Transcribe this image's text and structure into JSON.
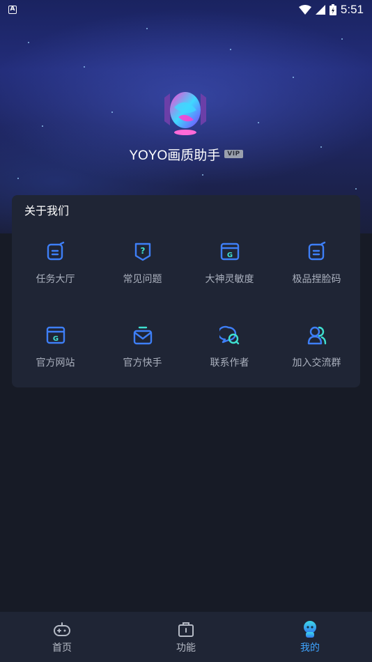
{
  "status_bar": {
    "time": "5:51",
    "badge": "A"
  },
  "app": {
    "name": "YOYO画质助手",
    "vip": "VIP"
  },
  "card": {
    "title": "关于我们",
    "items": [
      {
        "label": "任务大厅",
        "icon": "edit-icon"
      },
      {
        "label": "常见问题",
        "icon": "question-icon"
      },
      {
        "label": "大神灵敏度",
        "icon": "browser-g-icon"
      },
      {
        "label": "极品捏脸码",
        "icon": "edit-icon"
      },
      {
        "label": "官方网站",
        "icon": "browser-g-icon"
      },
      {
        "label": "官方快手",
        "icon": "inbox-icon"
      },
      {
        "label": "联系作者",
        "icon": "chat-icon"
      },
      {
        "label": "加入交流群",
        "icon": "group-icon"
      }
    ]
  },
  "bottom_nav": [
    {
      "label": "首页",
      "icon": "gamepad-icon"
    },
    {
      "label": "功能",
      "icon": "toolbox-icon"
    },
    {
      "label": "我的",
      "icon": "robot-icon",
      "active": true
    }
  ],
  "colors": {
    "accent": "#3fa4ff",
    "icon_blue": "#3e7ff7",
    "card_bg": "#1f2535",
    "page_bg": "#171b26"
  }
}
